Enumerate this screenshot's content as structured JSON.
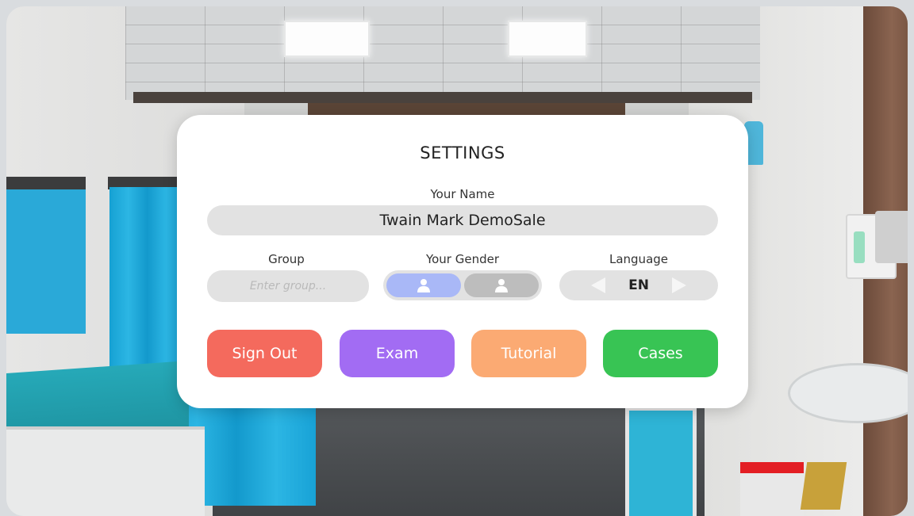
{
  "settings": {
    "title": "SETTINGS",
    "name_label": "Your Name",
    "name_value": "Twain Mark DemoSale",
    "group_label": "Group",
    "group_placeholder": "Enter group...",
    "gender_label": "Your Gender",
    "gender_options": [
      {
        "icon": "person-icon",
        "selected": true
      },
      {
        "icon": "person-icon",
        "selected": false
      }
    ],
    "language_label": "Language",
    "language_value": "EN",
    "buttons": {
      "sign_out": "Sign Out",
      "exam": "Exam",
      "tutorial": "Tutorial",
      "cases": "Cases"
    }
  },
  "colors": {
    "sign_out": "#f46a5d",
    "exam": "#a26cf3",
    "tutorial": "#fbaa73",
    "cases": "#38c454",
    "gender_selected": "#a9b8f7",
    "gender_unselected": "#bdbdbd"
  }
}
